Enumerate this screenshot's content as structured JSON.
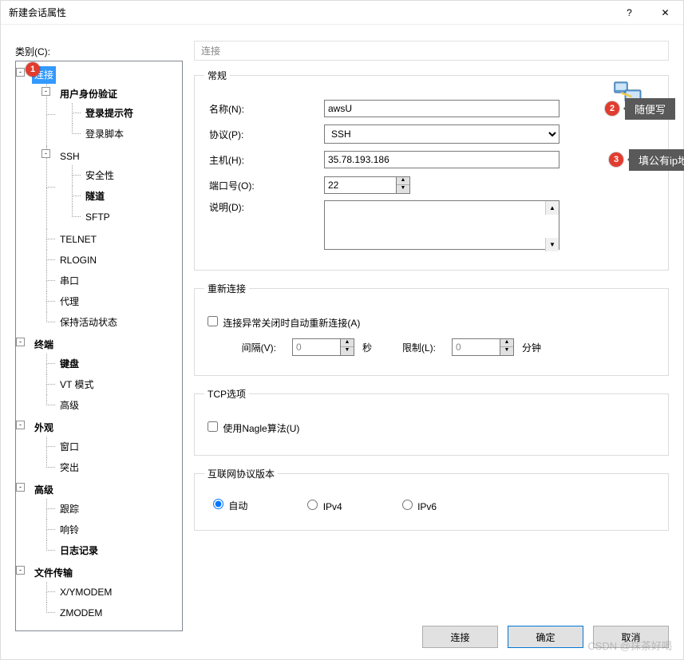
{
  "window": {
    "title": "新建会话属性",
    "help": "?",
    "close": "✕"
  },
  "category_label": "类别(C):",
  "tree": {
    "root": {
      "label": "连接",
      "exp": "-",
      "sel": true,
      "bold": false
    },
    "auth": {
      "label": "用户身份验证",
      "exp": "-",
      "bold": true
    },
    "loginprompt": {
      "label": "登录提示符",
      "bold": true
    },
    "loginscript": {
      "label": "登录脚本"
    },
    "ssh": {
      "label": "SSH",
      "exp": "-"
    },
    "security": {
      "label": "安全性"
    },
    "tunnel": {
      "label": "隧道",
      "bold": true
    },
    "sftp": {
      "label": "SFTP"
    },
    "telnet": {
      "label": "TELNET"
    },
    "rlogin": {
      "label": "RLOGIN"
    },
    "serial": {
      "label": "串口"
    },
    "proxy": {
      "label": "代理"
    },
    "keepalive": {
      "label": "保持活动状态"
    },
    "terminal": {
      "label": "终端",
      "exp": "-",
      "bold": true
    },
    "keyboard": {
      "label": "键盘",
      "bold": true
    },
    "vtmode": {
      "label": "VT 模式"
    },
    "advanced1": {
      "label": "高级"
    },
    "appearance": {
      "label": "外观",
      "exp": "-",
      "bold": true
    },
    "window2": {
      "label": "窗口"
    },
    "popup": {
      "label": "突出"
    },
    "advanced2": {
      "label": "高级",
      "exp": "-",
      "bold": true
    },
    "tracking": {
      "label": "跟踪"
    },
    "bell": {
      "label": "响铃"
    },
    "logging": {
      "label": "日志记录",
      "bold": true
    },
    "transfer": {
      "label": "文件传输",
      "exp": "-",
      "bold": true
    },
    "xymodem": {
      "label": "X/YMODEM"
    },
    "zmodem": {
      "label": "ZMODEM"
    }
  },
  "section_header": "连接",
  "general": {
    "legend": "常规",
    "name_label": "名称(N):",
    "name_value": "awsU",
    "protocol_label": "协议(P):",
    "protocol_value": "SSH",
    "host_label": "主机(H):",
    "host_value": "35.78.193.186",
    "port_label": "端口号(O):",
    "port_value": "22",
    "desc_label": "说明(D):",
    "desc_value": ""
  },
  "reconnect": {
    "legend": "重新连接",
    "chk_label": "连接异常关闭时自动重新连接(A)",
    "interval_label": "间隔(V):",
    "interval_value": "0",
    "seconds": "秒",
    "limit_label": "限制(L):",
    "limit_value": "0",
    "minutes": "分钟"
  },
  "tcp": {
    "legend": "TCP选项",
    "nagle_label": "使用Nagle算法(U)"
  },
  "ipver": {
    "legend": "互联网协议版本",
    "auto": "自动",
    "ipv4": "IPv4",
    "ipv6": "IPv6"
  },
  "footer": {
    "connect": "连接",
    "ok": "确定",
    "cancel": "取消"
  },
  "annotations": {
    "b1": "1",
    "b2": "2",
    "b3": "3",
    "t2": "随便写",
    "t3": "填公有ip地址"
  },
  "watermark": "CSDN @抹茶好喝"
}
